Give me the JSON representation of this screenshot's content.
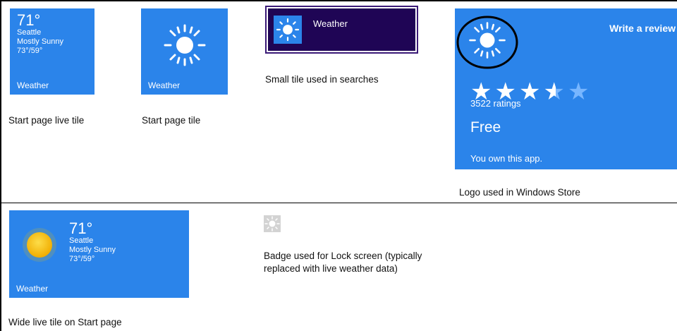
{
  "live_tile": {
    "temperature": "71°",
    "city": "Seattle",
    "condition": "Mostly Sunny",
    "range": "73°/59°",
    "app_name": "Weather",
    "caption": "Start page live tile"
  },
  "start_tile": {
    "app_name": "Weather",
    "caption": "Start page tile"
  },
  "search_tile": {
    "app_name": "Weather",
    "caption": "Small tile used in searches"
  },
  "store": {
    "write_review": "Write a review",
    "rating": 3.5,
    "rating_max": 5,
    "ratings_count": "3522 ratings",
    "price": "Free",
    "ownership": "You own this app.",
    "caption": "Logo used in Windows Store"
  },
  "wide_tile": {
    "temperature": "71°",
    "city": "Seattle",
    "condition": "Mostly Sunny",
    "range": "73°/59°",
    "app_name": "Weather",
    "caption": "Wide live tile on Start page"
  },
  "badge": {
    "caption_line1": "Badge used for Lock screen (typically",
    "caption_line2": "replaced with live weather data)"
  },
  "colors": {
    "tile_blue": "#2b84ea",
    "search_bg": "#1f0555",
    "sun_yellow": "#f5c400",
    "star_dim": "#78b6ff"
  }
}
